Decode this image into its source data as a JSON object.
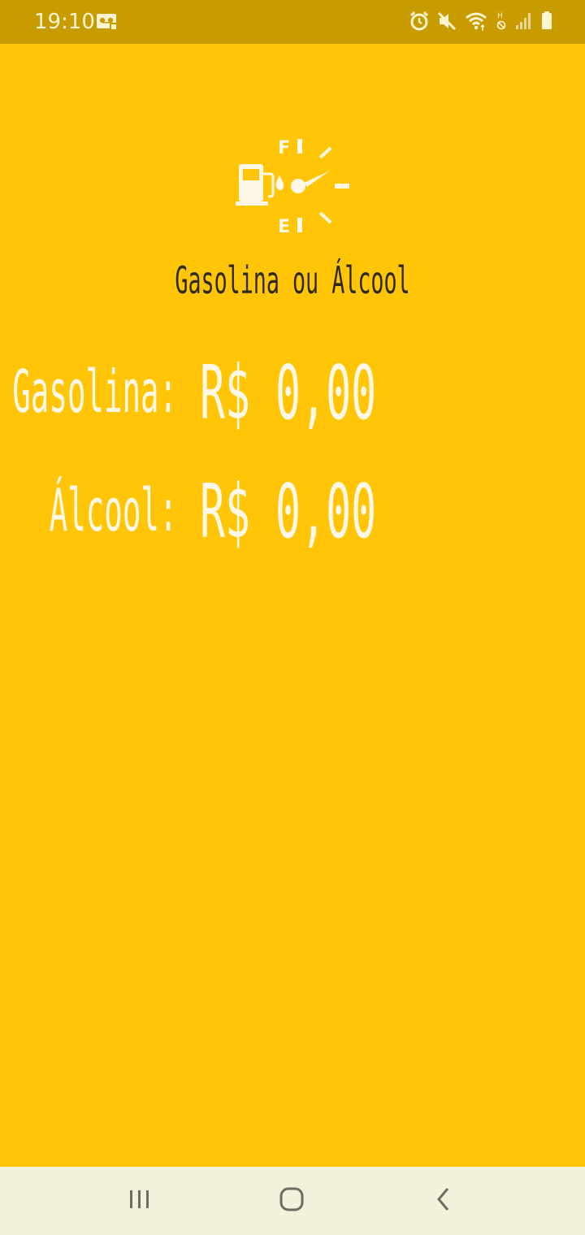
{
  "status_bar": {
    "time": "19:10",
    "icons": [
      "voicemail-icon",
      "alarm-icon",
      "mute-icon",
      "wifi-icon",
      "hd-signal-icon",
      "cellular-signal-icon",
      "battery-icon"
    ]
  },
  "app": {
    "logo_icon": "fuel-gauge-icon",
    "logo_gauge_marks": {
      "full": "F",
      "empty": "E"
    },
    "title": "Gasolina ou Álcool",
    "prices": [
      {
        "label": "Gasolina:",
        "value": "R$ 0,00"
      },
      {
        "label": "Álcool:",
        "value": "R$ 0,00"
      }
    ]
  },
  "nav_bar": {
    "buttons": [
      "recents-icon",
      "home-icon",
      "back-icon"
    ]
  },
  "colors": {
    "background": "#FFC506",
    "status_bar": "#C89B00",
    "nav_bar": "#F3F0DC",
    "text_light": "#FFF8E6",
    "title_text": "#2F2A1C"
  }
}
